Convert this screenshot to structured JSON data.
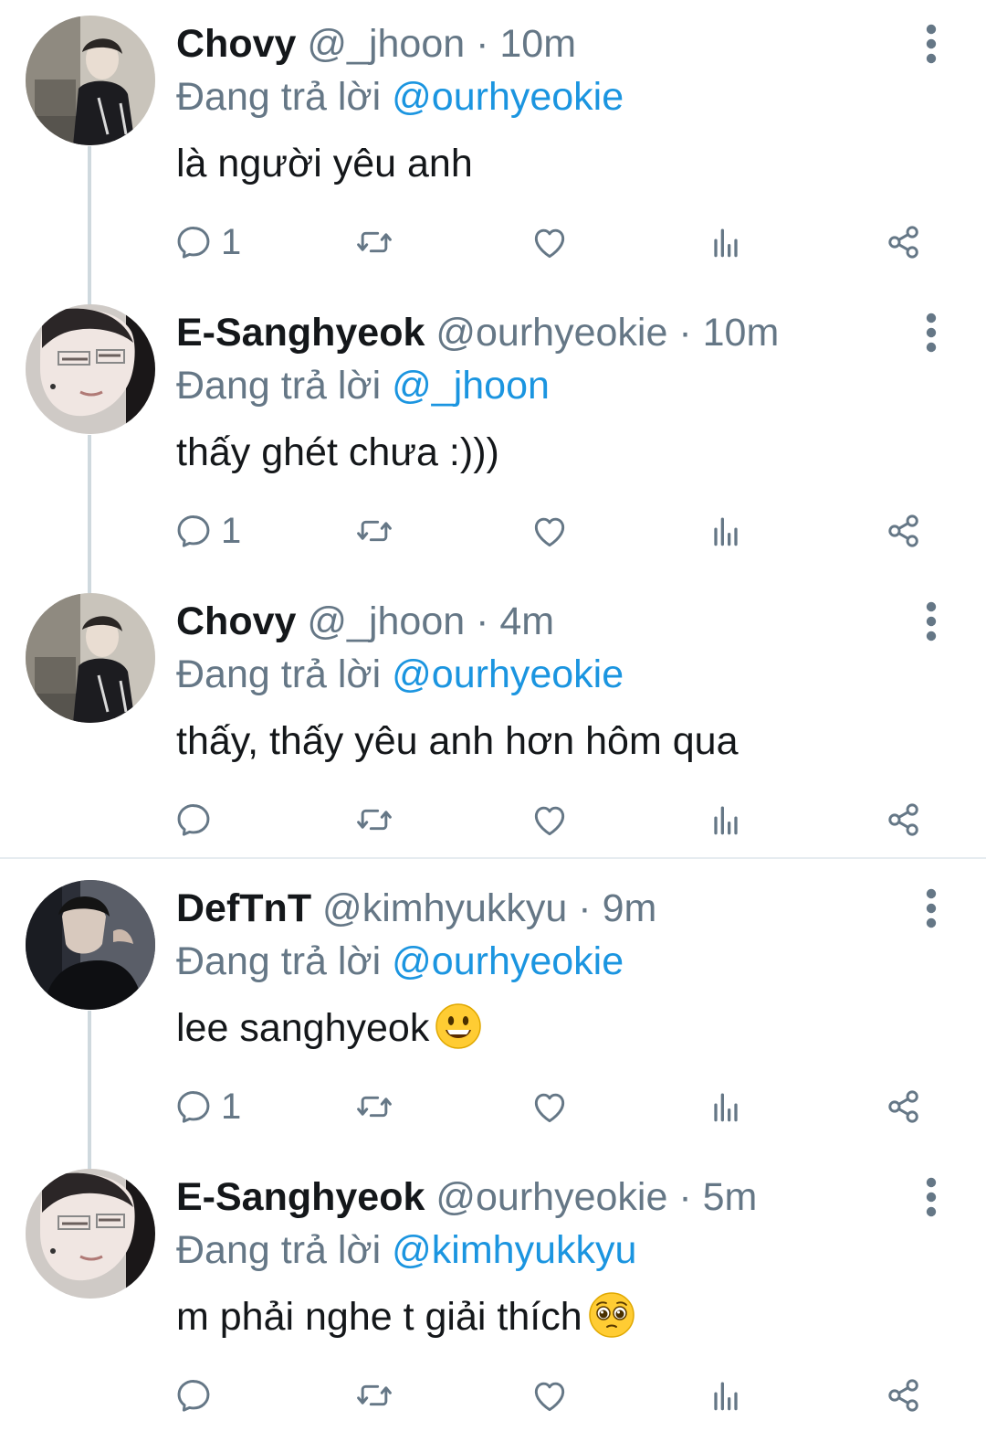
{
  "tweets": [
    {
      "name": "Chovy",
      "handle": "@_jhoon",
      "time": "10m",
      "reply_prefix": "Đang trả lời",
      "reply_to": "@ourhyeokie",
      "text": "là người yêu anh",
      "reply_count": "1",
      "avatar": "avatar-chovy"
    },
    {
      "name": "E-Sanghyeok",
      "handle": "@ourhyeokie",
      "time": "10m",
      "reply_prefix": "Đang trả lời",
      "reply_to": "@_jhoon",
      "text": "thấy ghét chưa :)))",
      "reply_count": "1",
      "avatar": "avatar-sanghyeok"
    },
    {
      "name": "Chovy",
      "handle": "@_jhoon",
      "time": "4m",
      "reply_prefix": "Đang trả lời",
      "reply_to": "@ourhyeokie",
      "text": "thấy, thấy yêu anh hơn hôm qua",
      "reply_count": "",
      "avatar": "avatar-chovy"
    },
    {
      "name": "DefTnT",
      "handle": "@kimhyukkyu",
      "time": "9m",
      "reply_prefix": "Đang trả lời",
      "reply_to": "@ourhyeokie",
      "text": "lee sanghyeok",
      "emoji": "grinning-face-emoji",
      "reply_count": "1",
      "avatar": "avatar-deft"
    },
    {
      "name": "E-Sanghyeok",
      "handle": "@ourhyeokie",
      "time": "5m",
      "reply_prefix": "Đang trả lời",
      "reply_to": "@kimhyukkyu",
      "text": "m phải nghe t giải thích",
      "emoji": "pleading-face-emoji",
      "reply_count": "",
      "avatar": "avatar-sanghyeok"
    }
  ],
  "icons": {
    "reply": "reply-icon",
    "retweet": "retweet-icon",
    "like": "heart-icon",
    "analytics": "analytics-icon",
    "share": "share-icon",
    "more": "more-vertical-icon"
  },
  "colors": {
    "text": "#14171a",
    "secondary": "#657786",
    "link": "#1b95e0",
    "thread_line": "#cfd9de"
  }
}
